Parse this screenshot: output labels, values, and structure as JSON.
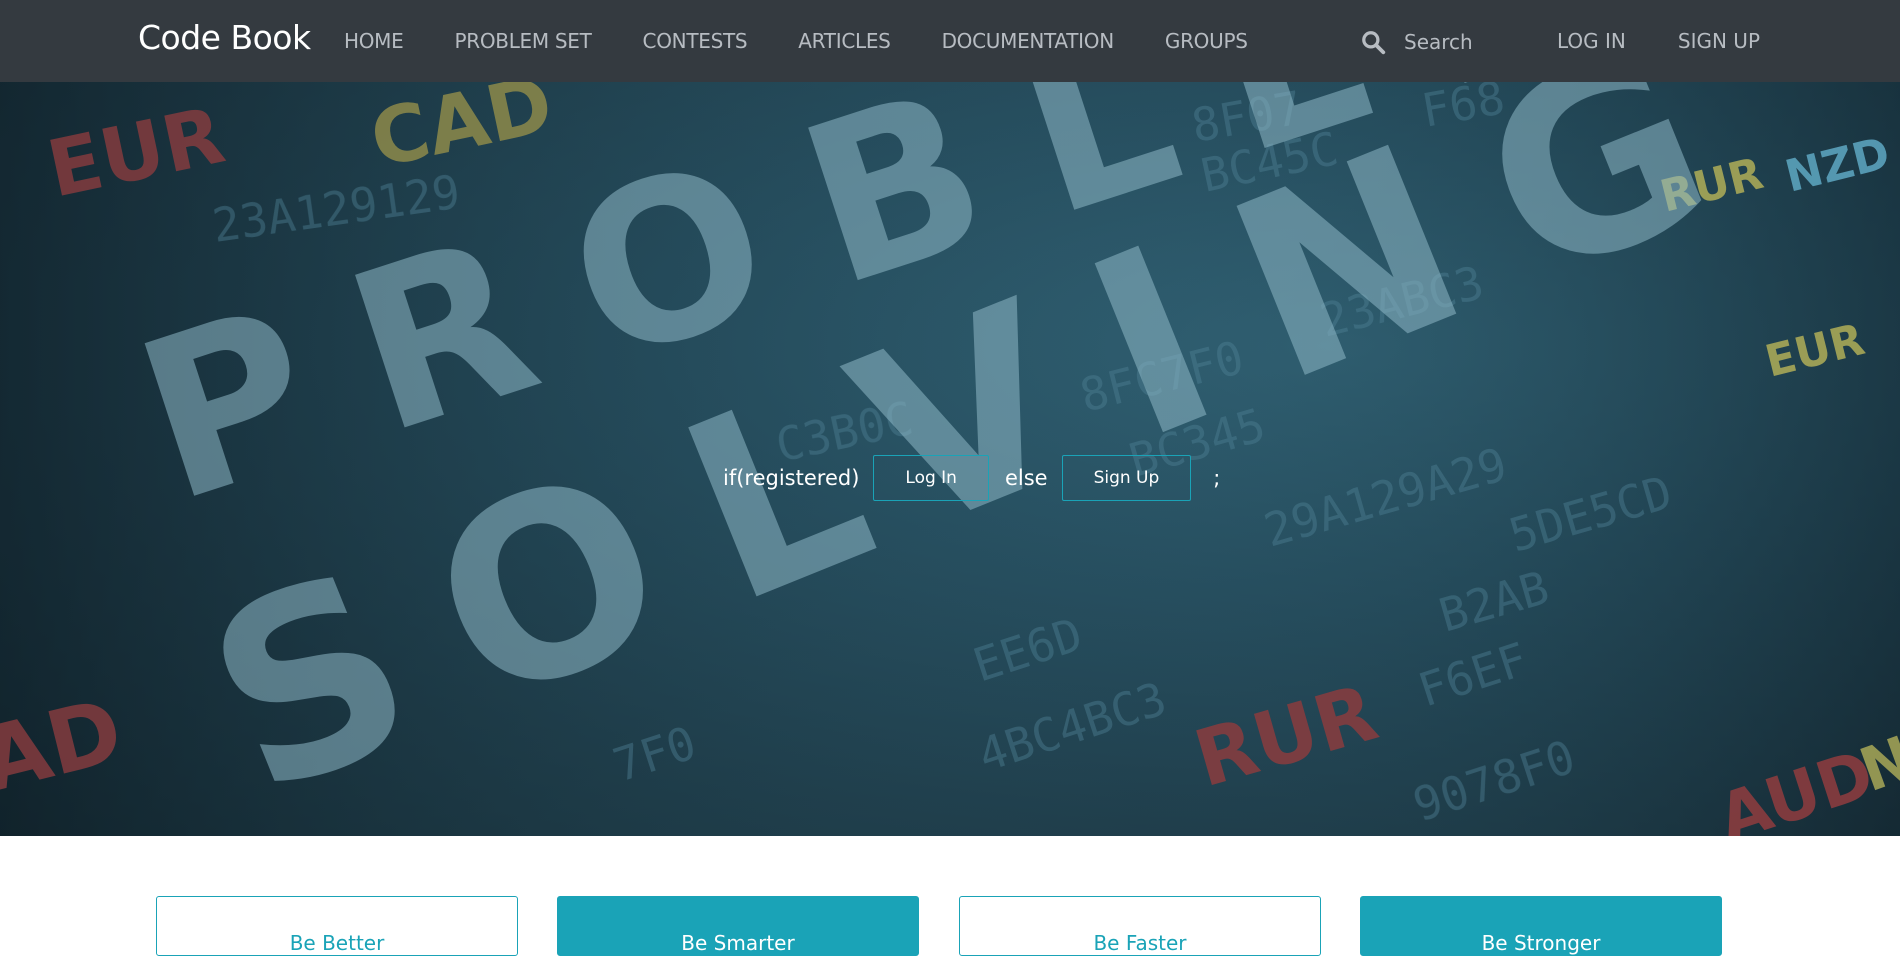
{
  "nav": {
    "brand": "Code Book",
    "items": [
      "HOME",
      "PROBLEM SET",
      "CONTESTS",
      "ARTICLES",
      "DOCUMENTATION",
      "GROUPS"
    ],
    "search_placeholder": "Search",
    "login": "LOG IN",
    "signup": "SIGN UP",
    "search_icon": "search-icon"
  },
  "hero": {
    "bg_text": {
      "problem": "PROBLEM",
      "solving": "SOLVING",
      "currencies": [
        "EUR",
        "CAD",
        "RUR",
        "NZD",
        "EUR",
        "RUR",
        "AUD",
        "AD",
        "N"
      ],
      "codes": [
        "23A129129",
        "8F07",
        "F68",
        "BC45C",
        "23ABC3",
        "8FC7F0",
        "BC345",
        "29A129A29",
        "5DE5CD",
        "B2AB",
        "F6EF",
        "4BC4BC3",
        "7F0",
        "C3B0C",
        "EE6D",
        "9078F0"
      ]
    },
    "cta": {
      "prefix": "if(registered)",
      "login_button": "Log In",
      "middle": "else",
      "signup_button": "Sign Up",
      "suffix": ";"
    }
  },
  "cards": [
    {
      "label": "Be Better",
      "style": "light"
    },
    {
      "label": "Be Smarter",
      "style": "dark"
    },
    {
      "label": "Be Faster",
      "style": "light"
    },
    {
      "label": "Be Stronger",
      "style": "dark"
    }
  ],
  "colors": {
    "navbar": "#343a40",
    "accent": "#1aa3b7"
  }
}
